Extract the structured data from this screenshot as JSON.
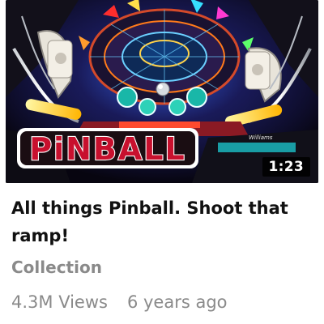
{
  "video": {
    "title": "All things Pinball. Shoot that ramp!",
    "duration": "1:23",
    "channel": "Collection",
    "views": "4.3M Views",
    "age": "6 years ago",
    "thumbnail_logo_text": "PiNBALL",
    "thumbnail_brand_text": "Williams"
  },
  "colors": {
    "title": "#111111",
    "secondary_text": "#8a8a8a",
    "badge_bg": "#000000",
    "logo_red": "#c8102e",
    "logo_outline": "#ffffff"
  }
}
